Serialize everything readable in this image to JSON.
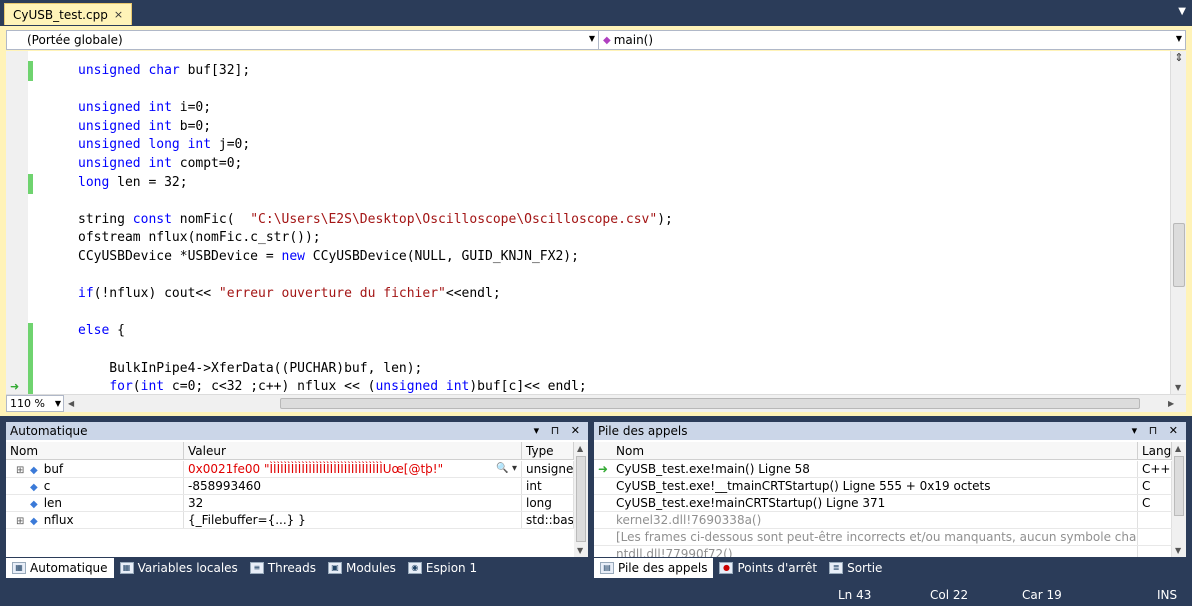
{
  "document_tab": {
    "title": "CyUSB_test.cpp",
    "close": "×"
  },
  "navbar": {
    "scope": "(Portée globale)",
    "member": "main()"
  },
  "code_lines": [
    [
      {
        "t": "unsigned char",
        "k": "kw"
      },
      {
        "t": " buf[32];"
      }
    ],
    [],
    [
      {
        "t": "unsigned int",
        "k": "kw"
      },
      {
        "t": " i=0;"
      }
    ],
    [
      {
        "t": "unsigned int",
        "k": "kw"
      },
      {
        "t": " b=0;"
      }
    ],
    [
      {
        "t": "unsigned long int",
        "k": "kw"
      },
      {
        "t": " j=0;"
      }
    ],
    [
      {
        "t": "unsigned int",
        "k": "kw"
      },
      {
        "t": " compt=0;"
      }
    ],
    [
      {
        "t": "long",
        "k": "kw"
      },
      {
        "t": " len = 32;"
      }
    ],
    [],
    [
      {
        "t": "string "
      },
      {
        "t": "const",
        "k": "kw"
      },
      {
        "t": " nomFic(  "
      },
      {
        "t": "\"C:\\Users\\E2S\\Desktop\\Oscilloscope\\Oscilloscope.csv\"",
        "k": "str"
      },
      {
        "t": ");"
      }
    ],
    [
      {
        "t": "ofstream nflux(nomFic.c_str());"
      }
    ],
    [
      {
        "t": "CCyUSBDevice *USBDevice = "
      },
      {
        "t": "new",
        "k": "kw"
      },
      {
        "t": " CCyUSBDevice(NULL, GUID_KNJN_FX2);"
      }
    ],
    [],
    [
      {
        "t": "if",
        "k": "kw"
      },
      {
        "t": "(!nflux) cout<< "
      },
      {
        "t": "\"erreur ouverture du fichier\"",
        "k": "str"
      },
      {
        "t": "<<endl;"
      }
    ],
    [],
    [
      {
        "t": "else",
        "k": "kw"
      },
      {
        "t": " {"
      }
    ],
    [],
    [
      {
        "t": "    BulkInPipe4->XferData((PUCHAR)buf, len);"
      }
    ],
    [
      {
        "t": "    "
      },
      {
        "t": "for",
        "k": "kw"
      },
      {
        "t": "("
      },
      {
        "t": "int",
        "k": "kw"
      },
      {
        "t": " c=0; c<32 ;c++) nflux << ("
      },
      {
        "t": "unsigned int",
        "k": "kw"
      },
      {
        "t": ")buf[c]<< endl;"
      }
    ]
  ],
  "zoom": "110 %",
  "autos_panel": {
    "title": "Automatique",
    "columns": [
      "Nom",
      "Valeur",
      "Type"
    ],
    "rows": [
      {
        "expand": "⊞",
        "name": "buf",
        "value": "0x0021fe00 \"ÌÌÌÌÌÌÌÌÌÌÌÌÌÌÌÌÌÌÌÌÌÌÌÌÌÌÌÌÌÌÌÌUœ[@tþ!\"",
        "type": "unsigned",
        "red": true
      },
      {
        "expand": "",
        "name": "c",
        "value": "-858993460",
        "type": "int",
        "red": false
      },
      {
        "expand": "",
        "name": "len",
        "value": "32",
        "type": "long",
        "red": false
      },
      {
        "expand": "⊞",
        "name": "nflux",
        "value": "{_Filebuffer={...} }",
        "type": "std::basic",
        "red": false
      }
    ],
    "tabs": [
      "Automatique",
      "Variables locales",
      "Threads",
      "Modules",
      "Espion 1"
    ]
  },
  "callstack_panel": {
    "title": "Pile des appels",
    "columns": [
      "Nom",
      "Lang"
    ],
    "rows": [
      {
        "name": "CyUSB_test.exe!main()  Ligne 58",
        "lang": "C++",
        "current": true,
        "gray": false
      },
      {
        "name": "CyUSB_test.exe!__tmainCRTStartup()  Ligne 555 + 0x19 octets",
        "lang": "C",
        "current": false,
        "gray": false
      },
      {
        "name": "CyUSB_test.exe!mainCRTStartup()  Ligne 371",
        "lang": "C",
        "current": false,
        "gray": false
      },
      {
        "name": "kernel32.dll!7690338a()",
        "lang": "",
        "current": false,
        "gray": true
      },
      {
        "name": "[Les frames ci-dessous sont peut-être incorrects et/ou manquants, aucun symbole chargé pour ker",
        "lang": "",
        "current": false,
        "gray": true
      },
      {
        "name": "ntdll.dll!77990f72()",
        "lang": "",
        "current": false,
        "gray": true
      }
    ],
    "tabs": [
      "Pile des appels",
      "Points d'arrêt",
      "Sortie"
    ]
  },
  "status_bar": {
    "ln": "Ln 43",
    "col": "Col 22",
    "car": "Car 19",
    "mode": "INS"
  },
  "colors": {
    "keyword": "#0000ff",
    "string": "#a31515",
    "chrome": "#2b3c59",
    "active_tab": "#fff3b8"
  }
}
